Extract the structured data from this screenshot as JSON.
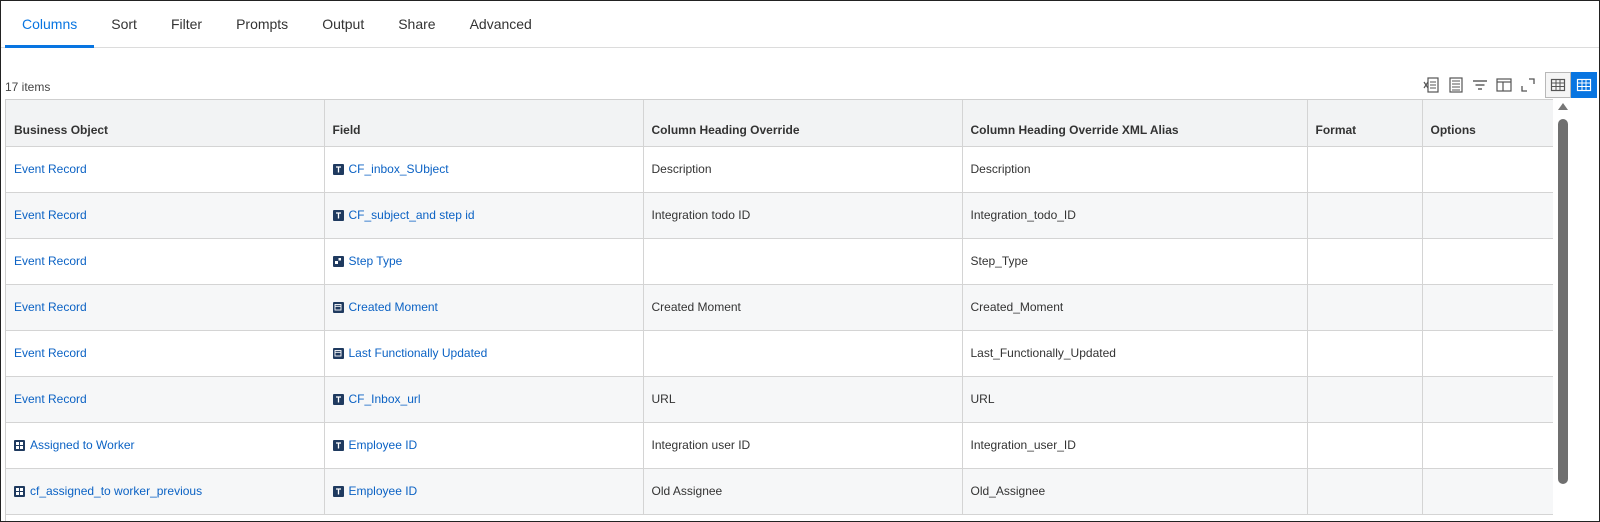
{
  "tabs": [
    "Columns",
    "Sort",
    "Filter",
    "Prompts",
    "Output",
    "Share",
    "Advanced"
  ],
  "active_tab": "Columns",
  "items_count": "17 items",
  "toolbar_icons": [
    "export-excel-icon",
    "export-pdf-icon",
    "filter-icon",
    "column-layout-icon",
    "expand-icon"
  ],
  "views": [
    "table-view-icon",
    "grid-view-icon"
  ],
  "colors": {
    "accent": "#0875e1",
    "link": "#0b62c4",
    "icon_dark": "#1f3a5f"
  },
  "table": {
    "headers": [
      "Business Object",
      "Field",
      "Column Heading Override",
      "Column Heading Override XML Alias",
      "Format",
      "Options"
    ],
    "rows": [
      {
        "bo": "Event Record",
        "bo_icon": "",
        "field_icon": "T",
        "field": "CF_inbox_SUbject",
        "override": "Description",
        "alias": "Description",
        "format": "",
        "options": ""
      },
      {
        "bo": "Event Record",
        "bo_icon": "",
        "field_icon": "T",
        "field": "CF_subject_and step id",
        "override": "Integration todo ID",
        "alias": "Integration_todo_ID",
        "format": "",
        "options": ""
      },
      {
        "bo": "Event Record",
        "bo_icon": "",
        "field_icon": "S",
        "field": "Step Type",
        "override": "",
        "alias": "Step_Type",
        "format": "",
        "options": ""
      },
      {
        "bo": "Event Record",
        "bo_icon": "",
        "field_icon": "D",
        "field": "Created Moment",
        "override": "Created Moment",
        "alias": "Created_Moment",
        "format": "",
        "options": ""
      },
      {
        "bo": "Event Record",
        "bo_icon": "",
        "field_icon": "D",
        "field": "Last Functionally Updated",
        "override": "",
        "alias": "Last_Functionally_Updated",
        "format": "",
        "options": ""
      },
      {
        "bo": "Event Record",
        "bo_icon": "",
        "field_icon": "T",
        "field": "CF_Inbox_url",
        "override": "URL",
        "alias": "URL",
        "format": "",
        "options": ""
      },
      {
        "bo": "Assigned to Worker",
        "bo_icon": "R",
        "field_icon": "T",
        "field": "Employee ID",
        "override": "Integration user ID",
        "alias": "Integration_user_ID",
        "format": "",
        "options": ""
      },
      {
        "bo": "cf_assigned_to worker_previous",
        "bo_icon": "R",
        "field_icon": "T",
        "field": "Employee ID",
        "override": "Old Assignee",
        "alias": "Old_Assignee",
        "format": "",
        "options": ""
      }
    ]
  }
}
